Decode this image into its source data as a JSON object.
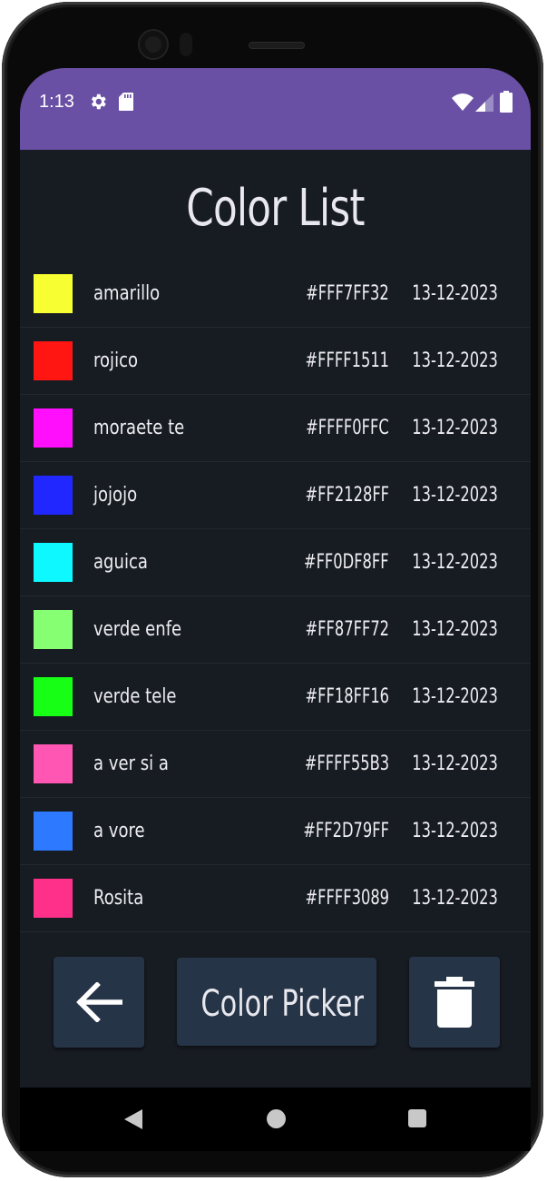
{
  "status_bar": {
    "time": "1:13",
    "settings_icon": "gear-icon",
    "sd_icon": "sd-card-icon",
    "wifi_icon": "wifi-icon",
    "signal_icon": "cell-signal-icon",
    "battery_icon": "battery-icon",
    "color": "#6a50a5"
  },
  "page": {
    "title": "Color List",
    "background": "#171b22"
  },
  "colors": [
    {
      "name": "amarillo",
      "hex": "#FFF7FF32",
      "date": "13-12-2023",
      "swatch": "#F7FF32"
    },
    {
      "name": "rojico",
      "hex": "#FFFF1511",
      "date": "13-12-2023",
      "swatch": "#FF1511"
    },
    {
      "name": "moraete te",
      "hex": "#FFFF0FFC",
      "date": "13-12-2023",
      "swatch": "#FF0FFC"
    },
    {
      "name": "jojojo",
      "hex": "#FF2128FF",
      "date": "13-12-2023",
      "swatch": "#2128FF"
    },
    {
      "name": "aguica",
      "hex": "#FF0DF8FF",
      "date": "13-12-2023",
      "swatch": "#0DF8FF"
    },
    {
      "name": "verde enfe",
      "hex": "#FF87FF72",
      "date": "13-12-2023",
      "swatch": "#87FF72"
    },
    {
      "name": "verde tele",
      "hex": "#FF18FF16",
      "date": "13-12-2023",
      "swatch": "#18FF16"
    },
    {
      "name": "a ver si a",
      "hex": "#FFFF55B3",
      "date": "13-12-2023",
      "swatch": "#FF55B3"
    },
    {
      "name": "a vore",
      "hex": "#FF2D79FF",
      "date": "13-12-2023",
      "swatch": "#2D79FF"
    },
    {
      "name": "Rosita",
      "hex": "#FFFF3089",
      "date": "13-12-2023",
      "swatch": "#FF3089"
    }
  ],
  "actions": {
    "back_icon": "arrow-left-icon",
    "picker_label": "Color Picker",
    "delete_icon": "trash-icon",
    "button_color": "#263447"
  },
  "nav_bar": {
    "back_icon": "nav-back-icon",
    "home_icon": "nav-home-icon",
    "recents_icon": "nav-recents-icon"
  }
}
